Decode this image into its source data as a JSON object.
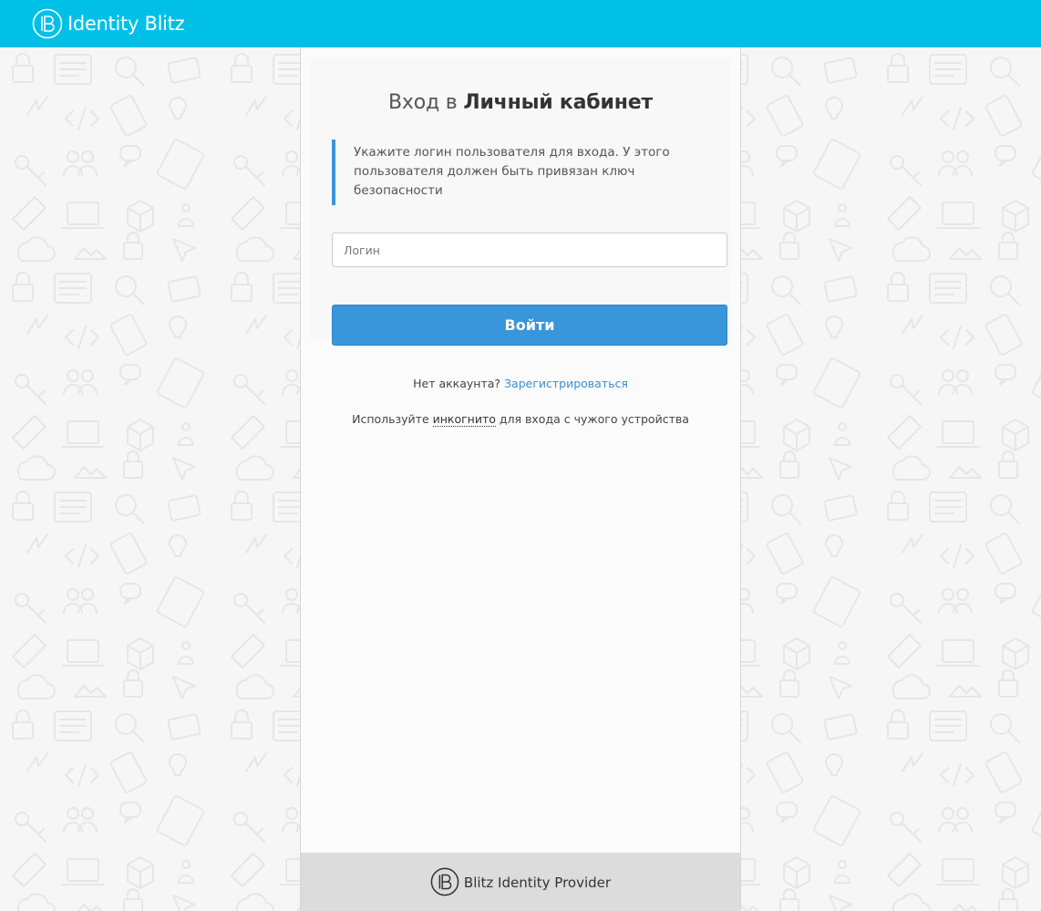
{
  "header": {
    "logo_icon": "blitz-b-circle-icon",
    "brand_name": "Identity Blitz"
  },
  "login": {
    "title_light": "Вход в",
    "title_bold": "Личный кабинет",
    "hint_text": "Укажите логин пользователя для входа. У этого пользователя должен быть привязан ключ безопасности",
    "login_field": {
      "placeholder": "Логин",
      "value": ""
    },
    "submit_label": "Войти",
    "register_prompt": "Нет аккаунта?",
    "register_link": "Зарегистрироваться",
    "incognito_prefix": "Используйте",
    "incognito_link": "инкогнито",
    "incognito_suffix": "для входа с чужого устройства"
  },
  "footer": {
    "logo_icon": "blitz-b-circle-icon",
    "text": "Blitz Identity Provider"
  },
  "colors": {
    "topbar": "#00c0e8",
    "accent": "#3a96db",
    "link": "#3a8fd0",
    "background": "#f6f6f6",
    "panel": "#fbfbfb",
    "footer": "#dcdcdc"
  }
}
